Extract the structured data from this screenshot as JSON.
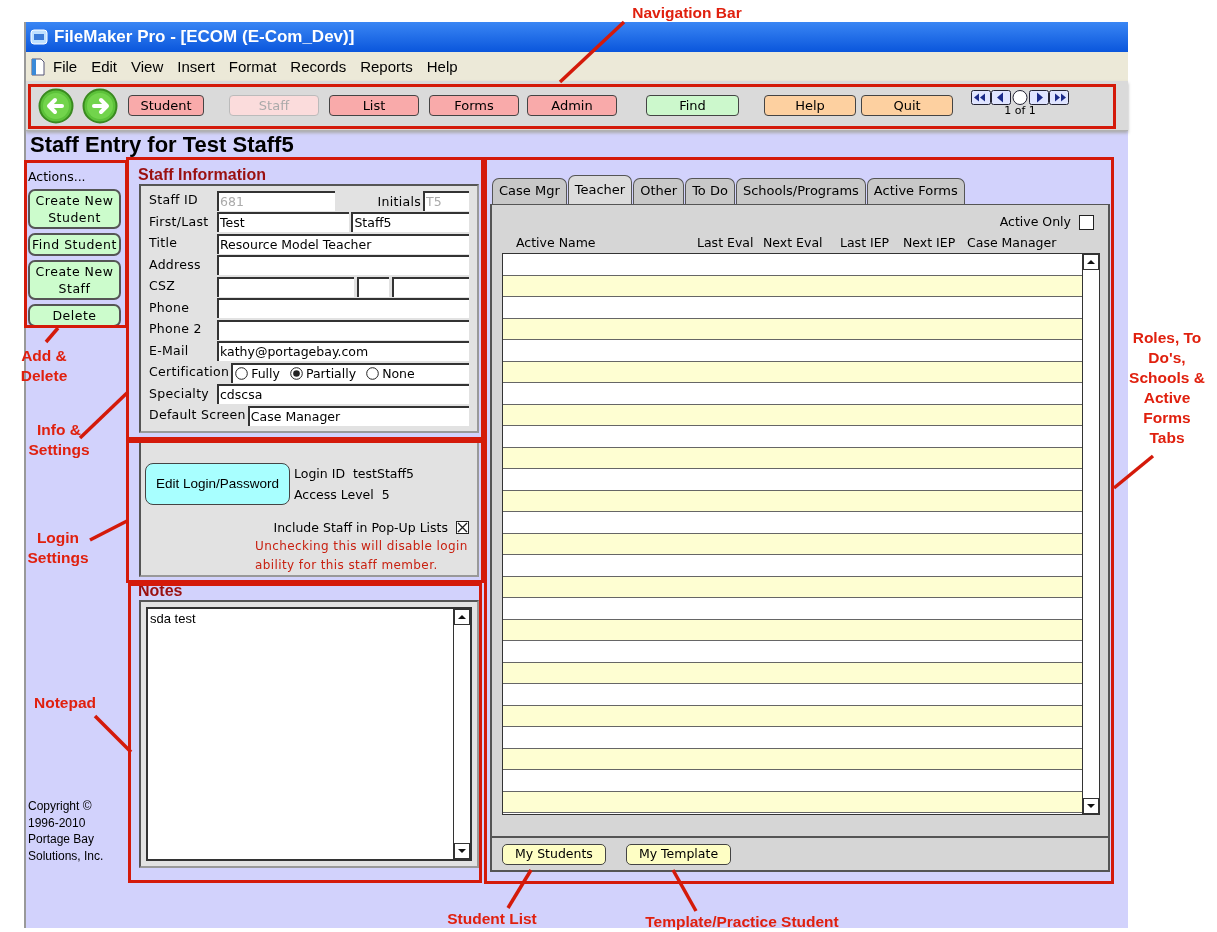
{
  "window": {
    "title": "FileMaker Pro - [ECOM (E-Com_Dev)]"
  },
  "menu": [
    "File",
    "Edit",
    "View",
    "Insert",
    "Format",
    "Records",
    "Reports",
    "Help"
  ],
  "toolbar": {
    "buttons": [
      {
        "label": "Student",
        "color": "#f9aaaa",
        "disabled": false
      },
      {
        "label": "Staff",
        "color": "#fbdcdc",
        "disabled": true
      },
      {
        "label": "List",
        "color": "#f9aaaa",
        "disabled": false
      },
      {
        "label": "Forms",
        "color": "#f9aaaa",
        "disabled": false
      },
      {
        "label": "Admin",
        "color": "#f9aaaa",
        "disabled": false
      },
      {
        "label": "Find",
        "color": "#ccf8cc",
        "disabled": false
      },
      {
        "label": "Help",
        "color": "#fdd0a0",
        "disabled": false
      },
      {
        "label": "Quit",
        "color": "#fdd0a0",
        "disabled": false
      }
    ],
    "record_position": "1 of 1"
  },
  "heading": "Staff Entry for Test Staff5",
  "actions": {
    "title": "Actions...",
    "buttons": [
      "Create New Student",
      "Find Student",
      "Create New Staff",
      "Delete"
    ]
  },
  "copyright": [
    "Copyright ©",
    "1996-2010",
    "Portage Bay",
    "Solutions, Inc."
  ],
  "staff_info": {
    "title": "Staff Information",
    "fields": [
      {
        "kind": "id",
        "label": "Staff ID",
        "value": "681",
        "initials_label": "Initials",
        "initials": "T5",
        "disabled": true
      },
      {
        "kind": "pair",
        "label": "First/Last",
        "values": [
          "Test",
          "Staff5"
        ]
      },
      {
        "kind": "text",
        "label": "Title",
        "value": "Resource Model Teacher"
      },
      {
        "kind": "text",
        "label": "Address"
      },
      {
        "kind": "csz",
        "label": "CSZ"
      },
      {
        "kind": "text",
        "label": "Phone"
      },
      {
        "kind": "text",
        "label": "Phone 2"
      },
      {
        "kind": "text",
        "label": "E-Mail",
        "value": "kathy@portagebay.com"
      },
      {
        "kind": "radio",
        "label": "Certification",
        "options": [
          {
            "label": "Fully",
            "selected": false
          },
          {
            "label": "Partially",
            "selected": true
          },
          {
            "label": "None",
            "selected": false
          }
        ]
      },
      {
        "kind": "text",
        "label": "Specialty",
        "value": "cdscsa"
      },
      {
        "kind": "text",
        "label": "Default Screen",
        "value": "Case Manager"
      }
    ]
  },
  "login": {
    "button": "Edit Login/Password",
    "login_id_label": "Login ID",
    "login_id": "testStaff5",
    "access_level_label": "Access Level",
    "access_level": "5",
    "include_label": "Include Staff in Pop-Up Lists",
    "include_checked": true,
    "warning": "Unchecking this will disable login ability for this staff member."
  },
  "notes": {
    "title": "Notes",
    "text": "sda test"
  },
  "tabs": [
    {
      "label": "Case Mgr",
      "selected": false
    },
    {
      "label": "Teacher",
      "selected": true
    },
    {
      "label": "Other",
      "selected": false
    },
    {
      "label": "To Do",
      "selected": false
    },
    {
      "label": "Schools/Programs",
      "selected": false
    },
    {
      "label": "Active Forms",
      "selected": false
    }
  ],
  "active_only": {
    "label": "Active Only",
    "checked": false
  },
  "columns": [
    "Active Name",
    "Last Eval",
    "Next Eval",
    "Last IEP",
    "Next IEP",
    "Case Manager"
  ],
  "bottom_buttons": [
    "My Students",
    "My Template"
  ],
  "annotations": [
    {
      "label": "Navigation Bar"
    },
    {
      "label": "Add & Delete"
    },
    {
      "label": "Info & Settings"
    },
    {
      "label": "Login Settings"
    },
    {
      "label": "Notepad"
    },
    {
      "label": "Roles, To Do's, Schools & Active Forms Tabs"
    },
    {
      "label": "Student List"
    },
    {
      "label": "Template/Practice Student"
    }
  ]
}
